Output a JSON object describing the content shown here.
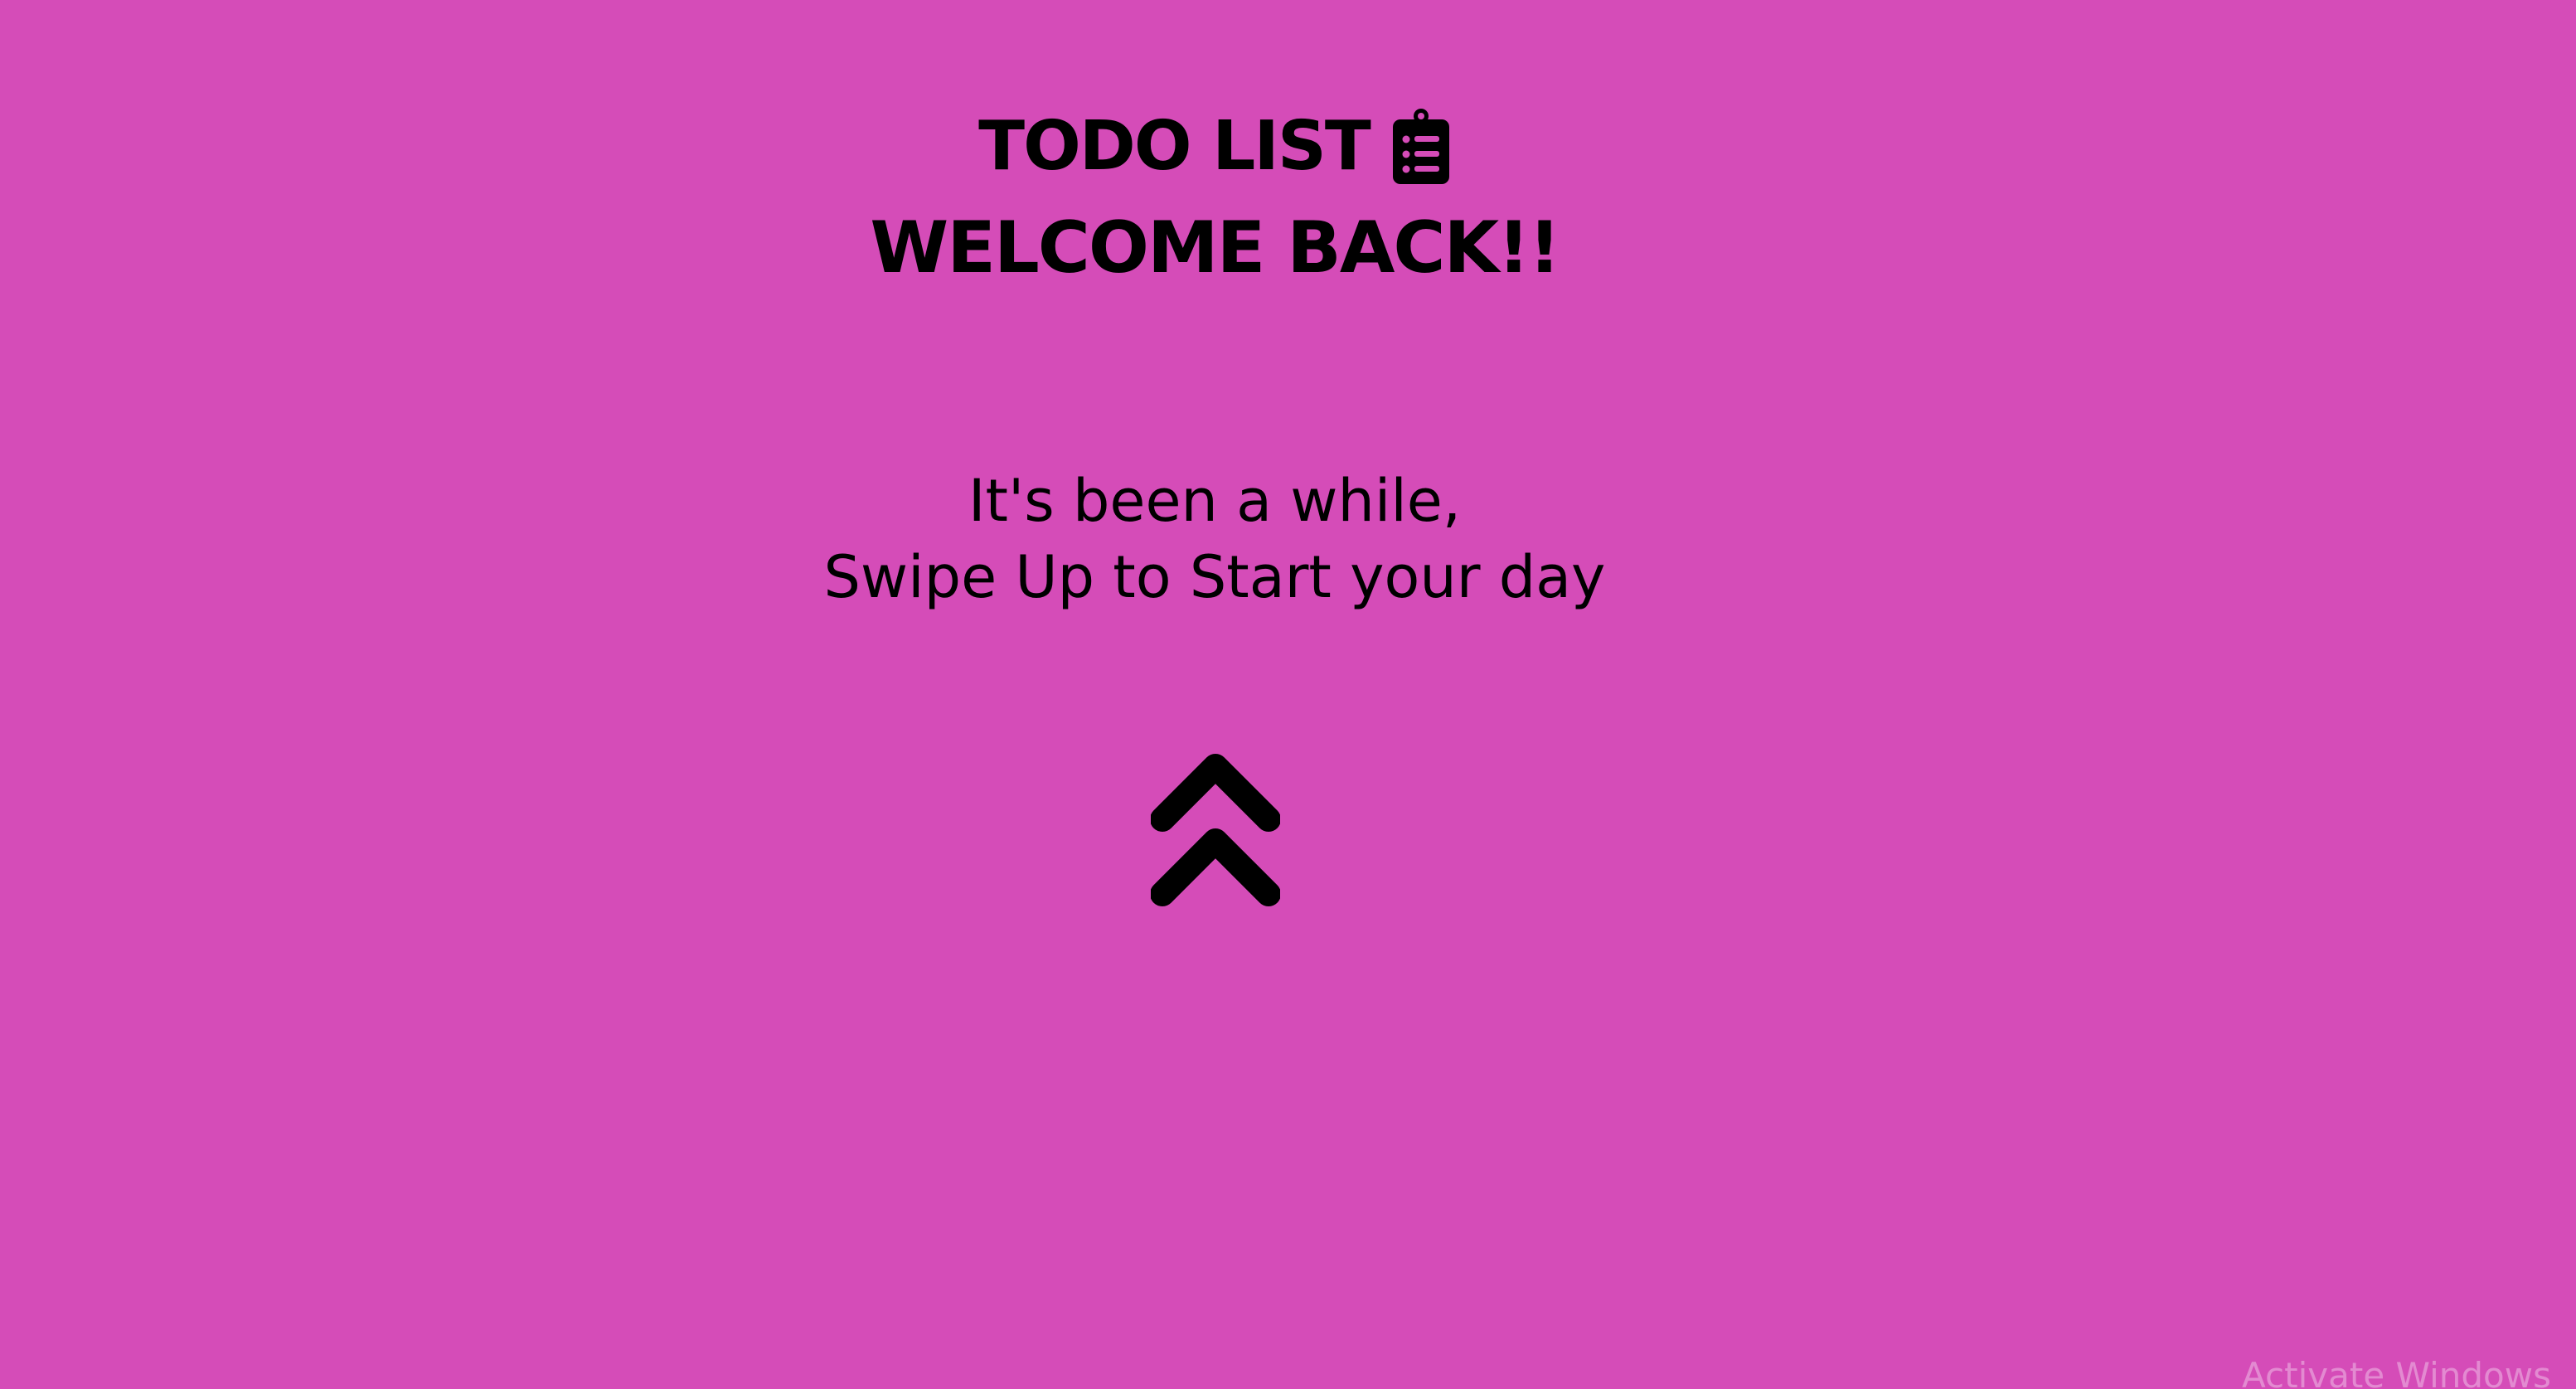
{
  "header": {
    "title": "TODO LIST",
    "title_icon": "clipboard-list-icon",
    "welcome": "WELCOME BACK!!"
  },
  "message": {
    "line1": "It's been a while,",
    "line2": "Swipe Up to Start your day"
  },
  "swipe": {
    "icon": "double-chevron-up-icon"
  },
  "system": {
    "watermark": "Activate Windows"
  },
  "colors": {
    "background": "#d54cb8",
    "text": "#000000"
  }
}
